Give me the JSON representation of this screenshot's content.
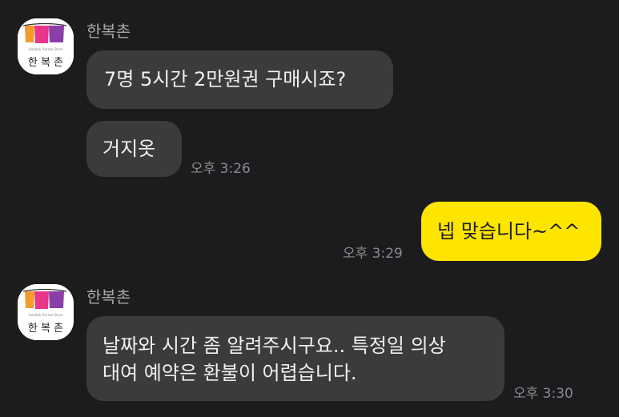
{
  "brand": {
    "romanization": "Hanbok Rental Store",
    "logo_text": "한 복 촌"
  },
  "messages": {
    "group1": {
      "sender": "한복촌",
      "bubble1": "7명 5시간 2만원권 구매시죠?",
      "bubble2": "거지옷",
      "time": "오후 3:26"
    },
    "mine": {
      "bubble": "넵 맞습니다~^^",
      "time": "오후 3:29"
    },
    "group2": {
      "sender": "한복촌",
      "line1": "날짜와 시간 좀 알려주시구요.. 특정일 의상",
      "line2": "대여 예약은 환불이 어렵습니다.",
      "time": "오후 3:30"
    }
  },
  "colors": {
    "background": "#1c1c1e",
    "bubble_other": "#3b3b3d",
    "bubble_mine": "#fee500",
    "text_light": "#f0f0f0",
    "time_text": "#8a8a8e",
    "logo_orange": "#f39a2b",
    "logo_pink": "#e8368a",
    "logo_purple": "#8a3fa8"
  }
}
